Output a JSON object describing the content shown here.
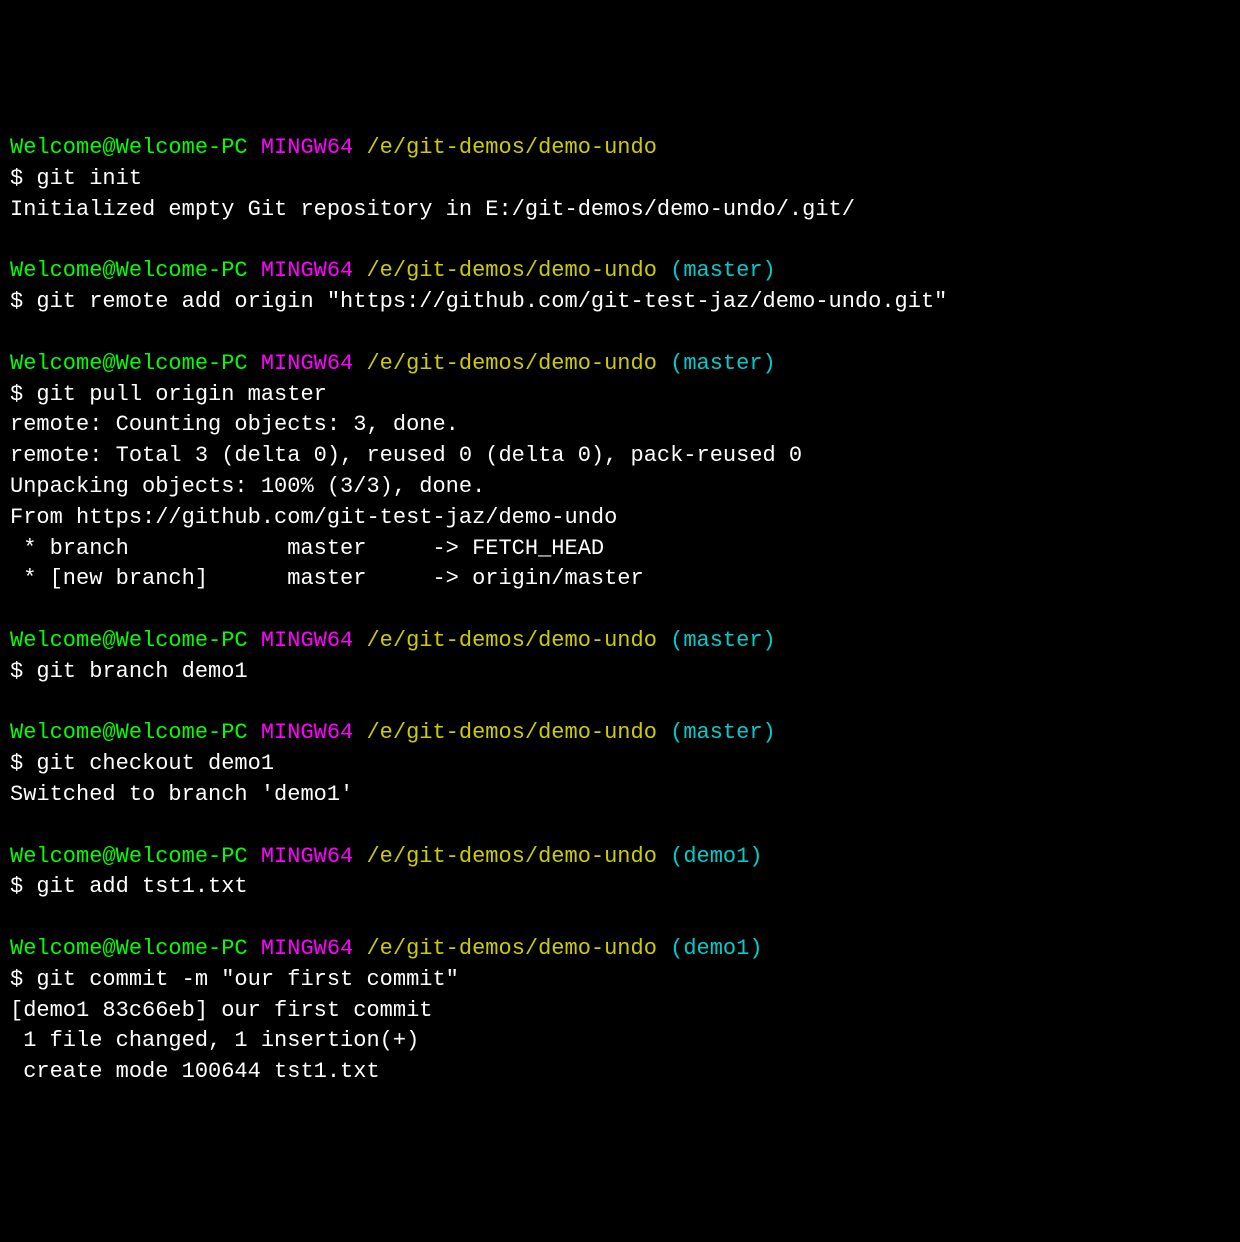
{
  "prompt": {
    "user_host": "Welcome@Welcome-PC",
    "sys": "MINGW64",
    "path": "/e/git-demos/demo-undo",
    "branch_master": "(master)",
    "branch_demo1": "(demo1)",
    "dollar": "$ "
  },
  "blocks": [
    {
      "cmd": "git init",
      "branch": "",
      "output": [
        "Initialized empty Git repository in E:/git-demos/demo-undo/.git/"
      ]
    },
    {
      "cmd": "git remote add origin \"https://github.com/git-test-jaz/demo-undo.git\"",
      "branch": "(master)",
      "output": []
    },
    {
      "cmd": "git pull origin master",
      "branch": "(master)",
      "output": [
        "remote: Counting objects: 3, done.",
        "remote: Total 3 (delta 0), reused 0 (delta 0), pack-reused 0",
        "Unpacking objects: 100% (3/3), done.",
        "From https://github.com/git-test-jaz/demo-undo",
        " * branch            master     -> FETCH_HEAD",
        " * [new branch]      master     -> origin/master"
      ]
    },
    {
      "cmd": "git branch demo1",
      "branch": "(master)",
      "output": []
    },
    {
      "cmd": "git checkout demo1",
      "branch": "(master)",
      "output": [
        "Switched to branch 'demo1'"
      ]
    },
    {
      "cmd": "git add tst1.txt",
      "branch": "(demo1)",
      "output": []
    },
    {
      "cmd": "git commit -m \"our first commit\"",
      "branch": "(demo1)",
      "output": [
        "[demo1 83c66eb] our first commit",
        " 1 file changed, 1 insertion(+)",
        " create mode 100644 tst1.txt"
      ]
    }
  ]
}
